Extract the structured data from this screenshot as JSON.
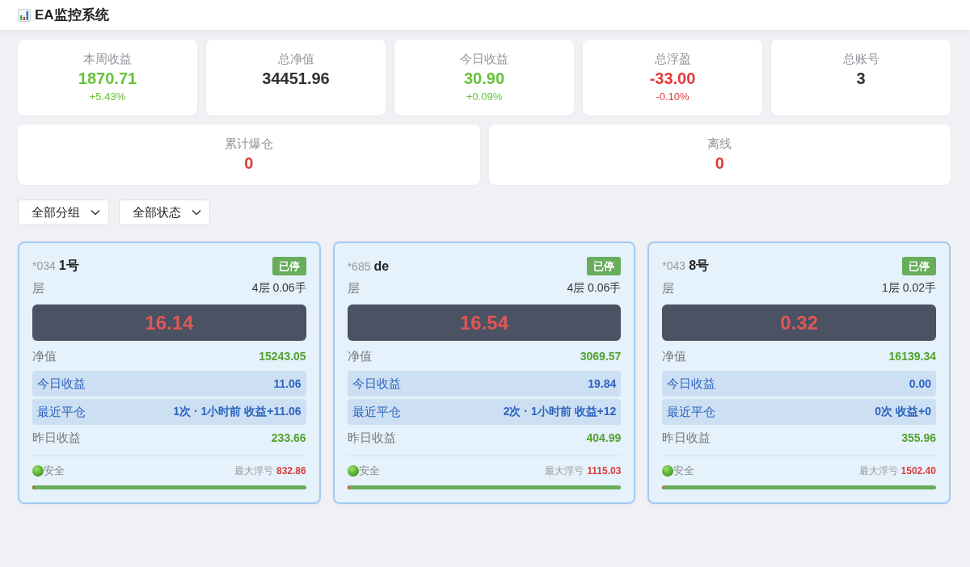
{
  "header": {
    "title": "EA监控系统"
  },
  "summary_rows": [
    {
      "cards": [
        {
          "label": "本周收益",
          "value": "1870.71",
          "change": "+5.43%",
          "color": "#67c23a"
        },
        {
          "label": "总净值",
          "value": "34451.96",
          "color": "#303133"
        },
        {
          "label": "今日收益",
          "value": "30.90",
          "change": "+0.09%",
          "color": "#67c23a"
        },
        {
          "label": "总浮盈",
          "value": "-33.00",
          "change": "-0.10%",
          "color": "#e03b3b"
        },
        {
          "label": "总账号",
          "value": "3",
          "color": "#303133"
        }
      ]
    },
    {
      "cards": [
        {
          "label": "累计爆仓",
          "value": "0",
          "color": "#e03b3b"
        },
        {
          "label": "离线",
          "value": "0",
          "color": "#e03b3b"
        }
      ]
    }
  ],
  "filters": [
    {
      "value": "全部分组"
    },
    {
      "value": "全部状态"
    }
  ],
  "accounts": [
    {
      "id": "*034",
      "name": "1号",
      "status": "已停",
      "layer_label": "层",
      "layers": "4层 0.06手",
      "floating": "16.14",
      "rows": [
        {
          "label": "净值",
          "value": "15243.05",
          "kind": "plain"
        },
        {
          "label": "今日收益",
          "value": "11.06",
          "kind": "highlight"
        },
        {
          "label": "最近平仓",
          "value": "1次 · 1小时前 收益+11.06",
          "kind": "highlight"
        },
        {
          "label": "昨日收益",
          "value": "233.66",
          "kind": "plain"
        }
      ],
      "risk": "安全",
      "max_loss_label": "最大浮亏",
      "max_loss": "832.86",
      "level": 0.006
    },
    {
      "id": "*685",
      "name": "de",
      "status": "已停",
      "layer_label": "层",
      "layers": "4层 0.06手",
      "floating": "16.54",
      "rows": [
        {
          "label": "净值",
          "value": "3069.57",
          "kind": "plain"
        },
        {
          "label": "今日收益",
          "value": "19.84",
          "kind": "highlight"
        },
        {
          "label": "最近平仓",
          "value": "2次 · 1小时前 收益+12",
          "kind": "highlight"
        },
        {
          "label": "昨日收益",
          "value": "404.99",
          "kind": "plain"
        }
      ],
      "risk": "安全",
      "max_loss_label": "最大浮亏",
      "max_loss": "1115.03",
      "level": 0.006
    },
    {
      "id": "*043",
      "name": "8号",
      "status": "已停",
      "layer_label": "层",
      "layers": "1层 0.02手",
      "floating": "0.32",
      "rows": [
        {
          "label": "净值",
          "value": "16139.34",
          "kind": "plain"
        },
        {
          "label": "今日收益",
          "value": "0.00",
          "kind": "highlight"
        },
        {
          "label": "最近平仓",
          "value": "0次 收益+0",
          "kind": "highlight"
        },
        {
          "label": "昨日收益",
          "value": "355.96",
          "kind": "plain"
        }
      ],
      "risk": "安全",
      "max_loss_label": "最大浮亏",
      "max_loss": "1502.40",
      "level": 0.003
    }
  ]
}
